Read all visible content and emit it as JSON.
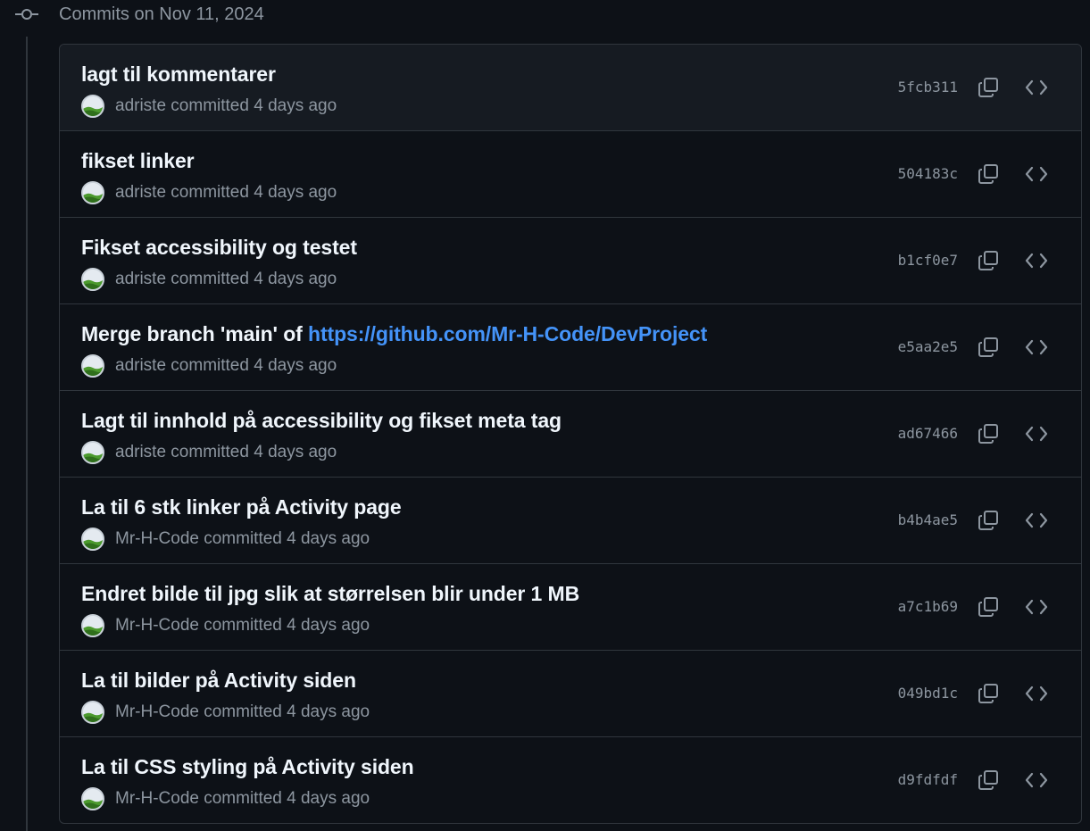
{
  "group": {
    "title": "Commits on Nov 11, 2024",
    "icon": "git-commit-icon"
  },
  "colors": {
    "background": "#0d1117",
    "row_hover": "#161b22",
    "border": "#30363d",
    "muted_text": "#8d96a0",
    "title_text": "#f0f6fc",
    "link": "#4493f8"
  },
  "commits": [
    {
      "title": "lagt til kommentarer",
      "title_link": "",
      "author": "adriste",
      "meta": "adriste committed 4 days ago",
      "sha": "5fcb311"
    },
    {
      "title": "fikset linker",
      "title_link": "",
      "author": "adriste",
      "meta": "adriste committed 4 days ago",
      "sha": "504183c"
    },
    {
      "title": "Fikset accessibility og testet",
      "title_link": "",
      "author": "adriste",
      "meta": "adriste committed 4 days ago",
      "sha": "b1cf0e7"
    },
    {
      "title": "Merge branch 'main' of ",
      "title_link": "https://github.com/Mr-H-Code/DevProject",
      "author": "adriste",
      "meta": "adriste committed 4 days ago",
      "sha": "e5aa2e5"
    },
    {
      "title": "Lagt til innhold på accessibility og fikset meta tag",
      "title_link": "",
      "author": "adriste",
      "meta": "adriste committed 4 days ago",
      "sha": "ad67466"
    },
    {
      "title": "La til 6 stk linker på Activity page",
      "title_link": "",
      "author": "Mr-H-Code",
      "meta": "Mr-H-Code committed 4 days ago",
      "sha": "b4b4ae5"
    },
    {
      "title": "Endret bilde til jpg slik at størrelsen blir under 1 MB",
      "title_link": "",
      "author": "Mr-H-Code",
      "meta": "Mr-H-Code committed 4 days ago",
      "sha": "a7c1b69"
    },
    {
      "title": "La til bilder på Activity siden",
      "title_link": "",
      "author": "Mr-H-Code",
      "meta": "Mr-H-Code committed 4 days ago",
      "sha": "049bd1c"
    },
    {
      "title": "La til CSS styling på Activity siden",
      "title_link": "",
      "author": "Mr-H-Code",
      "meta": "Mr-H-Code committed 4 days ago",
      "sha": "d9fdfdf"
    }
  ],
  "icons": {
    "copy": "copy-icon",
    "browse": "code-icon",
    "avatar": "avatar-image"
  }
}
